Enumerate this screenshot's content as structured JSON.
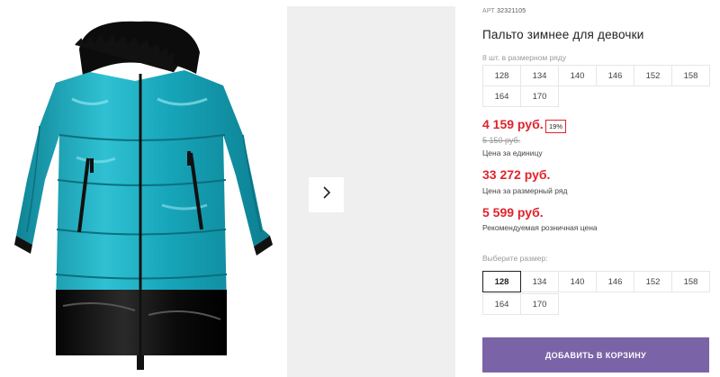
{
  "product": {
    "sku_label": "АРТ",
    "sku_code": "32321105",
    "title": "Пальто зимнее для девочки"
  },
  "size_row": {
    "label": "8 шт. в размерном ряду",
    "sizes": [
      "128",
      "134",
      "140",
      "146",
      "152",
      "158",
      "164",
      "170"
    ]
  },
  "pricing": {
    "unit_price": "4 159 руб.",
    "discount": "19%",
    "old_price": "5 150 руб.",
    "unit_price_label": "Цена за единицу",
    "row_price": "33 272 руб.",
    "row_price_label": "Цена за размерный ряд",
    "retail_price": "5 599 руб.",
    "retail_price_label": "Рекомендуемая розничная цена"
  },
  "size_select": {
    "label": "Выберите размер:",
    "sizes": [
      "128",
      "134",
      "140",
      "146",
      "152",
      "158",
      "164",
      "170"
    ],
    "selected": "128"
  },
  "cart": {
    "button_label": "ДОБАВИТЬ В КОРЗИНУ"
  },
  "colors": {
    "accent_price": "#e0232c",
    "cart_button": "#7b63a8",
    "coat_main": "#1aa3b8",
    "coat_bottom": "#111111"
  },
  "icons": {
    "next": "chevron-right-icon"
  }
}
